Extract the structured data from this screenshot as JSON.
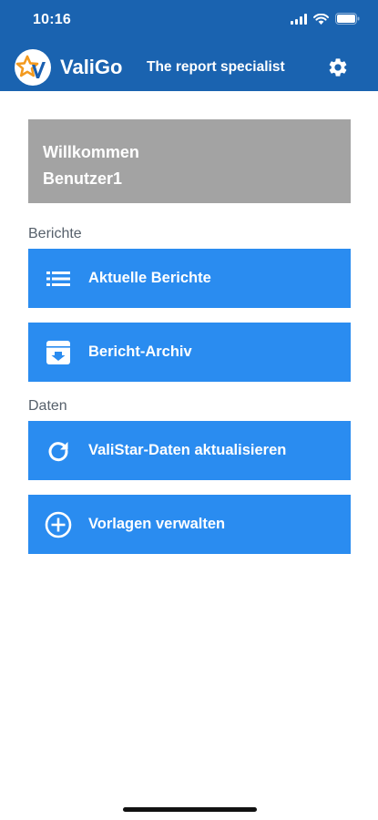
{
  "status_bar": {
    "time": "10:16"
  },
  "app_bar": {
    "app_name": "ValiGo",
    "subtitle": "The report specialist",
    "logo_icon": "valigo-star-logo",
    "settings_icon": "gear-icon"
  },
  "welcome": {
    "line1": "Willkommen",
    "line2": "Benutzer1"
  },
  "sections": {
    "reports_label": "Berichte",
    "data_label": "Daten"
  },
  "buttons": {
    "current_reports": "Aktuelle Berichte",
    "report_archive": "Bericht-Archiv",
    "update_data": "ValiStar-Daten aktualisieren",
    "manage_templates": "Vorlagen verwalten"
  },
  "colors": {
    "header": "#1a63b0",
    "button": "#2a8cf0",
    "welcome_card": "#a3a3a3",
    "section_label": "#56606b"
  }
}
